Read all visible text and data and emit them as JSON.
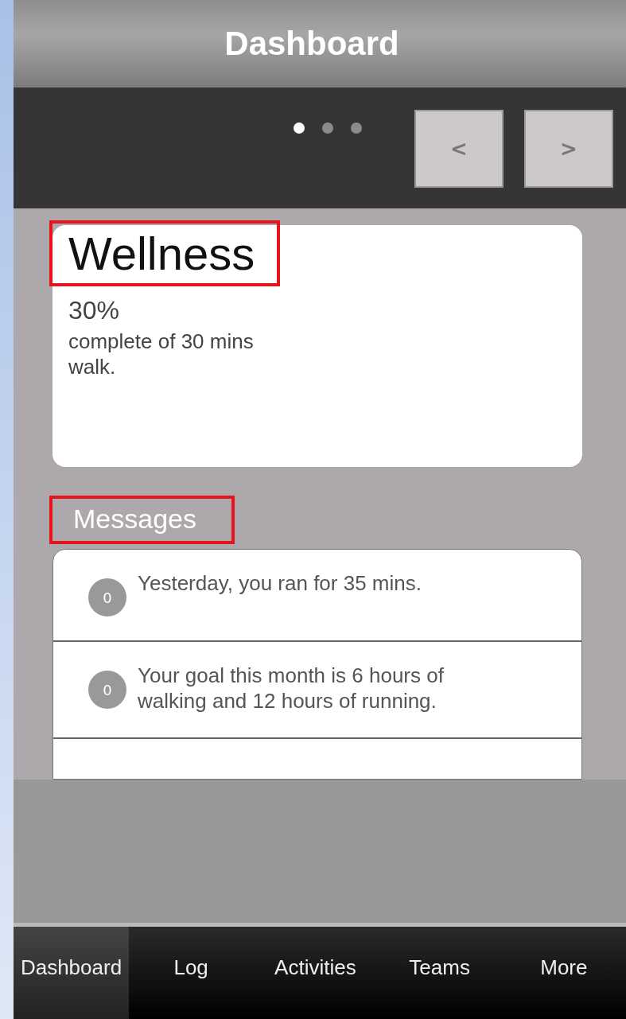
{
  "header": {
    "title": "Dashboard"
  },
  "carousel": {
    "pages": [
      {
        "selected": true
      },
      {
        "selected": false
      },
      {
        "selected": false
      }
    ],
    "prev_button": "<",
    "next_button": ">"
  },
  "card": {
    "title": "Wellness",
    "title_highlighted": true,
    "percent": "30%",
    "description": "complete of 30 mins walk."
  },
  "messages": {
    "heading": "Messages",
    "heading_highlighted": true,
    "items": [
      {
        "badge": "0",
        "text": "Yesterday, you ran for 35 mins."
      },
      {
        "badge": "0",
        "text": "Your goal this month is 6 hours of walking and 12 hours of running."
      }
    ]
  },
  "tabs": [
    {
      "label": "Dashboard",
      "selected": true
    },
    {
      "label": "Log",
      "selected": false
    },
    {
      "label": "Activities",
      "selected": false
    },
    {
      "label": "Teams",
      "selected": false
    },
    {
      "label": "More",
      "selected": false
    }
  ]
}
